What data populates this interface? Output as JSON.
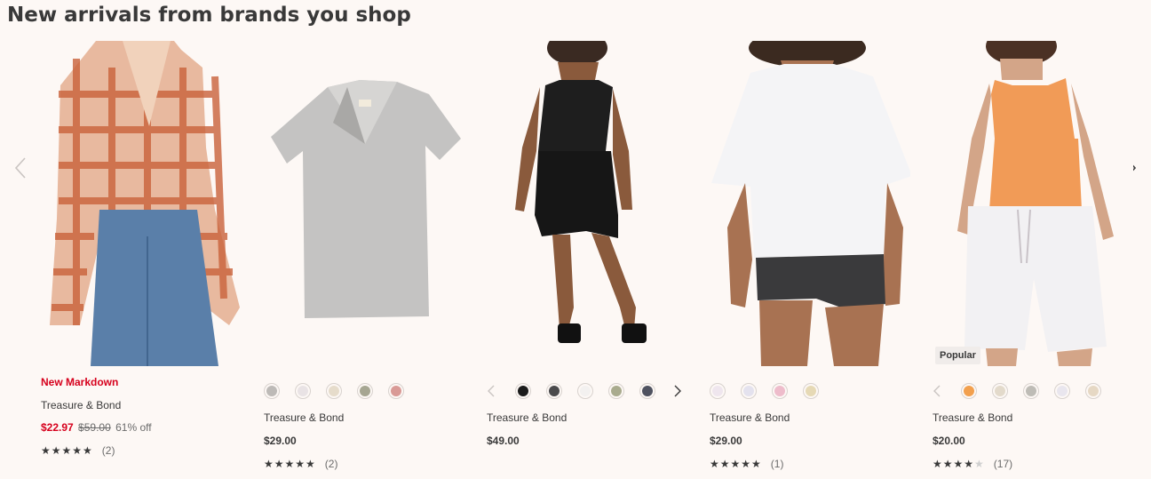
{
  "section": {
    "title": "New arrivals from brands you shop"
  },
  "carousel": {
    "prev_icon": "chevron-left-icon",
    "next_icon": "chevron-right-icon"
  },
  "products": [
    {
      "badge_top": "New Markdown",
      "brand": "Treasure & Bond",
      "sale_price": "$22.97",
      "original_price": "$59.00",
      "discount": "61% off",
      "rating": 5,
      "rating_count": "(2)",
      "colors": []
    },
    {
      "brand": "Treasure & Bond",
      "price": "$29.00",
      "rating": 5,
      "rating_count": "(2)",
      "colors": [
        "#bdbab7",
        "#e9e3e5",
        "#e6dccb",
        "#a6a692",
        "#d99a96"
      ]
    },
    {
      "brand": "Treasure & Bond",
      "price": "$49.00",
      "colors": [
        "#1b1b1b",
        "#4a4a4c",
        "#f3f1f0",
        "#a9ab8e",
        "#4f5260"
      ]
    },
    {
      "brand": "Treasure & Bond",
      "price": "$29.00",
      "rating": 5,
      "rating_count": "(1)",
      "colors": [
        "#efe6ee",
        "#e4e2ee",
        "#eebccb",
        "#e6d9b5"
      ]
    },
    {
      "badge_image": "Popular",
      "brand": "Treasure & Bond",
      "price": "$20.00",
      "rating": 4,
      "rating_count": "(17)",
      "colors": [
        "#f2a04e",
        "#e3dacb",
        "#bebcb6",
        "#e9e6ee",
        "#e6d8c4"
      ]
    }
  ]
}
